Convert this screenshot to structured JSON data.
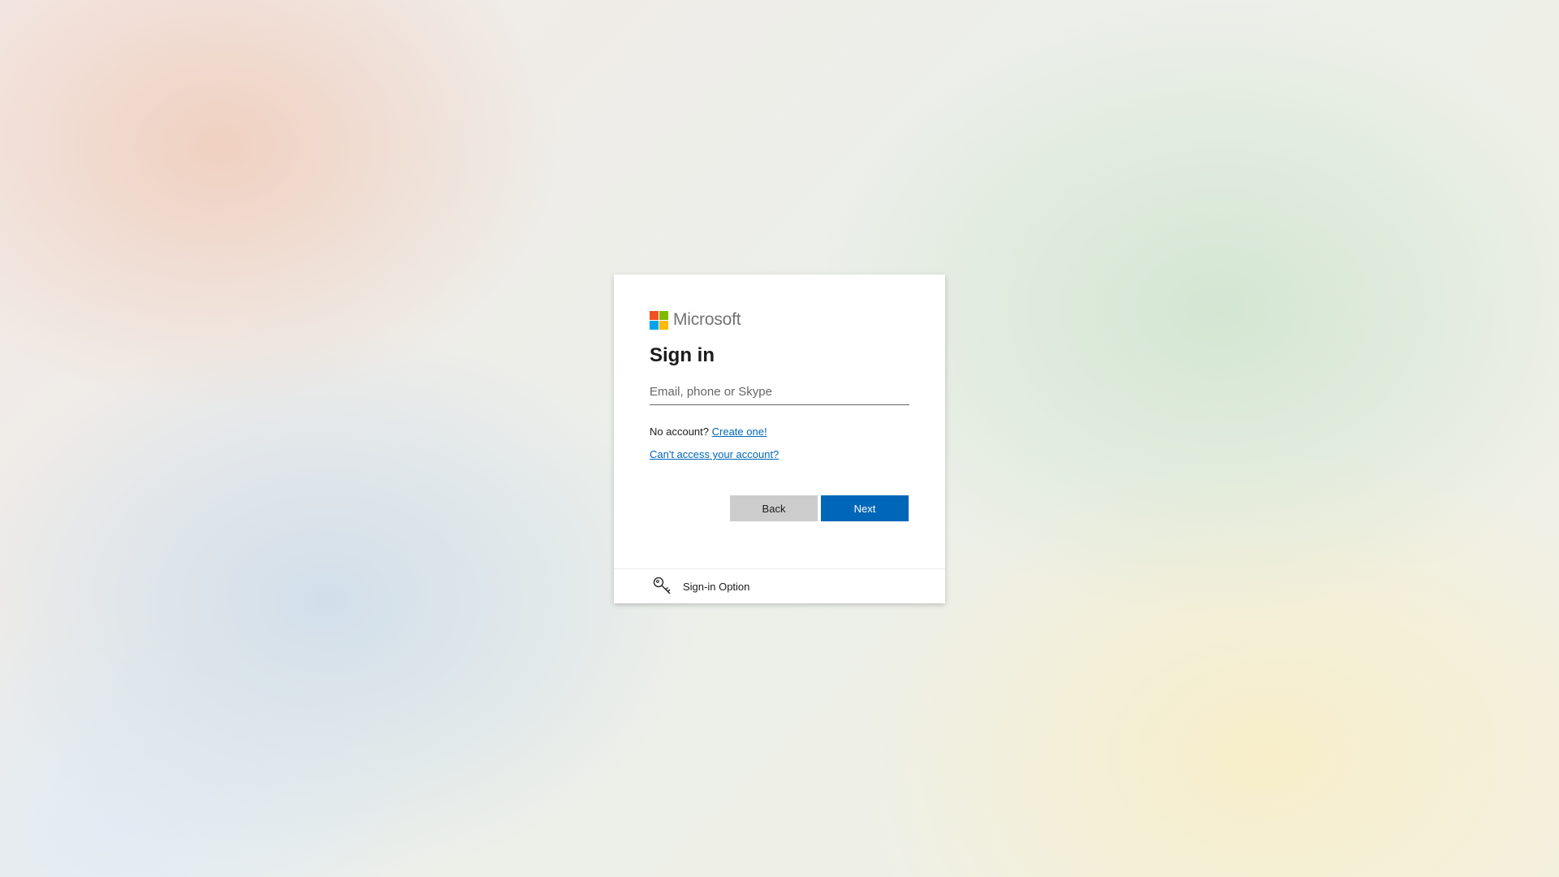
{
  "brand": {
    "name": "Microsoft",
    "colors": {
      "red": "#f25022",
      "green": "#7fba00",
      "blue": "#00a4ef",
      "yellow": "#ffb900"
    }
  },
  "signin": {
    "title": "Sign in",
    "email_placeholder": "Email, phone or Skype",
    "email_value": "",
    "no_account_text": "No account?",
    "create_link": "Create one!",
    "cant_access_link": "Can't access your account?",
    "back_label": "Back",
    "next_label": "Next",
    "accent_color": "#0067b8"
  },
  "options": {
    "icon": "key-icon",
    "label": "Sign-in Option"
  }
}
